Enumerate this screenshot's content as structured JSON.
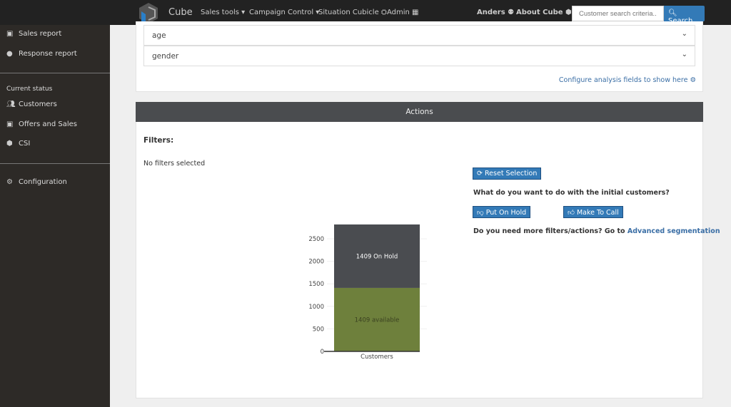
{
  "topbar": {
    "brand": "Cube",
    "nav": [
      "Sales tools ▾",
      "Campaign Control ▾",
      "Situation Cubicle ⛭",
      "Admin ▦"
    ],
    "user": "Anders ⚉",
    "about": "About Cube ⬢",
    "search_placeholder": "Customer search criteria...",
    "search_button": "Search"
  },
  "sidebar": {
    "items": [
      {
        "label": "Sales report",
        "icon": "gift-icon"
      },
      {
        "label": "Response report",
        "icon": "comments-icon"
      }
    ],
    "section": "Current status",
    "status_items": [
      {
        "label": "Customers",
        "icon": "users-icon"
      },
      {
        "label": "Offers and Sales",
        "icon": "gift-icon"
      },
      {
        "label": "CSI",
        "icon": "cube-icon"
      }
    ],
    "config": "Configuration"
  },
  "analysis": {
    "fields": [
      "age",
      "gender"
    ],
    "configure": "Configure analysis fields to show here"
  },
  "actions": {
    "title": "Actions",
    "filters_label": "Filters:",
    "no_filters": "No filters selected",
    "reset": "Reset Selection",
    "question": "What do you want to do with the initial customers?",
    "put_on_hold": "Put On Hold",
    "make_to_call": "Make To Call",
    "more_prefix": "Do you need more filters/actions? Go to",
    "more_link": "Advanced segmentation"
  },
  "chart_data": {
    "type": "bar",
    "stacked": true,
    "categories": [
      "Customers"
    ],
    "series": [
      {
        "values": [
          1409
        ],
        "label": "1409 available",
        "color": "#6e803c"
      },
      {
        "values": [
          1409
        ],
        "label": "1409 On Hold",
        "color": "#4a4c50"
      }
    ],
    "yticks": [
      0,
      500,
      1000,
      1500,
      2000,
      2500
    ],
    "ylim": [
      0,
      2900
    ],
    "grid": true
  }
}
